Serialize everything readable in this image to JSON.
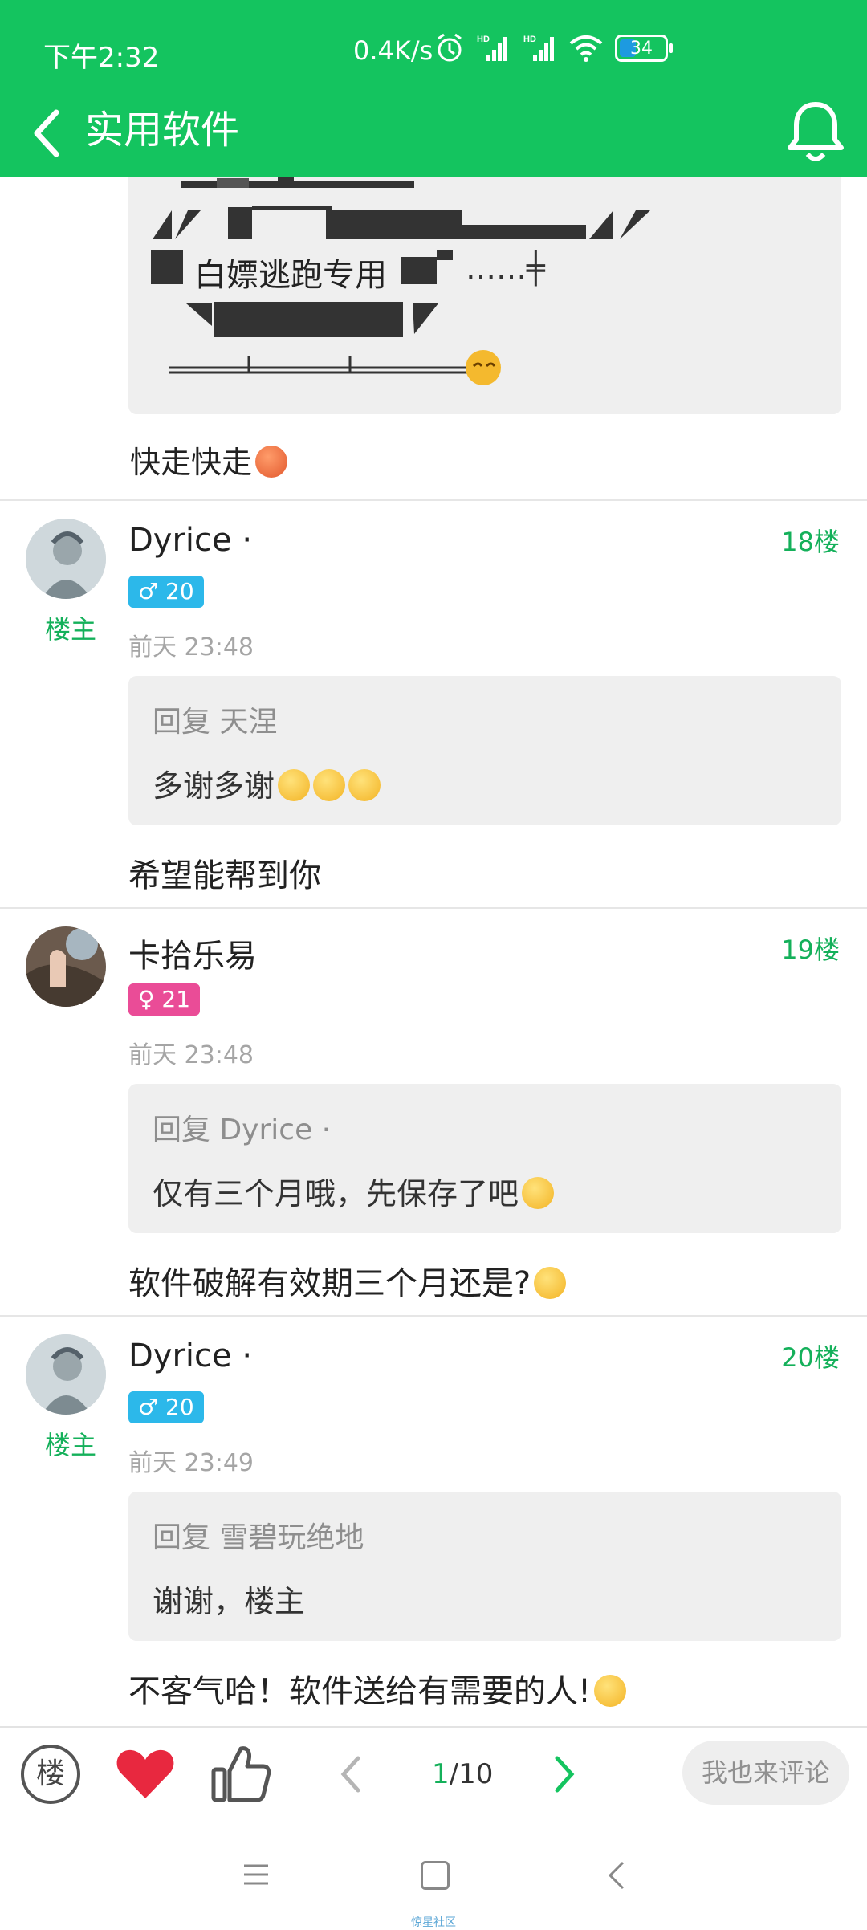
{
  "status_bar": {
    "time": "下午2:32",
    "speed": "0.4K/s",
    "battery": "34",
    "hd": "HD"
  },
  "navbar": {
    "title": "实用软件"
  },
  "prev_post": {
    "art_text": "白嫖逃跑专用",
    "art_tail": "……╪",
    "body": "快走快走"
  },
  "posts": [
    {
      "username": "Dyrice ·",
      "floor": "18楼",
      "gender": "♂",
      "age": "20",
      "owner_label": "楼主",
      "time": "前天 23:48",
      "quote_head": "回复 天涅",
      "quote_body": "多谢多谢",
      "body": "希望能帮到你"
    },
    {
      "username": "卡拾乐易",
      "floor": "19楼",
      "gender": "♀",
      "age": "21",
      "time": "前天 23:48",
      "quote_head": "回复 Dyrice ·",
      "quote_body": "仅有三个月哦，先保存了吧",
      "body": "软件破解有效期三个月还是?"
    },
    {
      "username": "Dyrice ·",
      "floor": "20楼",
      "gender": "♂",
      "age": "20",
      "owner_label": "楼主",
      "time": "前天 23:49",
      "quote_head": "回复 雪碧玩绝地",
      "quote_body": "谢谢，楼主",
      "body": "不客气哈！软件送给有需要的人!"
    }
  ],
  "actionbar": {
    "floor_btn": "楼",
    "page_current": "1",
    "page_total": "/10",
    "comment_placeholder": "我也来评论"
  },
  "brand": "惊星社区",
  "colors": {
    "accent": "#14c45f",
    "heart": "#e8283f",
    "male": "#2cb8ea",
    "female": "#ea4c97"
  }
}
